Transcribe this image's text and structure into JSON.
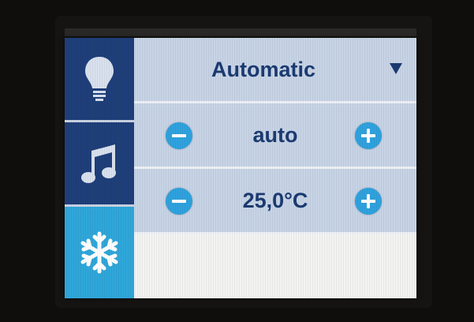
{
  "sidebar": {
    "items": [
      {
        "name": "light",
        "icon": "lightbulb-icon",
        "active": false
      },
      {
        "name": "audio",
        "icon": "music-note-icon",
        "active": false
      },
      {
        "name": "climate",
        "icon": "snowflake-icon",
        "active": true
      }
    ]
  },
  "climate": {
    "mode_label": "Automatic",
    "fan_value": "auto",
    "temperature_value": "25,0°C"
  },
  "colors": {
    "sidebar_bg": "#1f3f7a",
    "sidebar_active": "#2fa7da",
    "row_bg": "#c7d4e6",
    "text": "#1b3b72",
    "button": "#2fa2de"
  }
}
